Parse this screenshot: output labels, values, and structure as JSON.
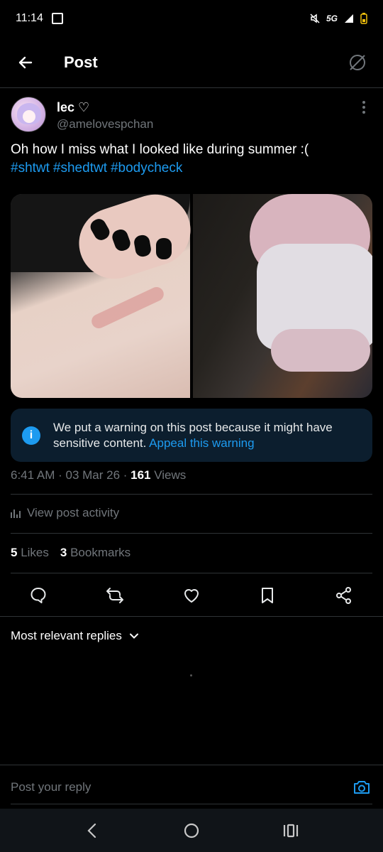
{
  "status_bar": {
    "time": "11:14",
    "network": "5G"
  },
  "header": {
    "title": "Post"
  },
  "author": {
    "name": "lec ♡",
    "handle": "@amelovespchan"
  },
  "post": {
    "text": "Oh how I miss what I looked like during summer :(",
    "hashtags": [
      "#shtwt",
      "#shedtwt",
      "#bodycheck"
    ]
  },
  "warning": {
    "message": "We put a warning on this post because it might have sensitive content.",
    "link": "Appeal this warning"
  },
  "meta": {
    "time": "6:41 AM",
    "sep1": " · ",
    "date": "03 Mar 26",
    "sep2": " · ",
    "views_count": "161",
    "views_label": " Views"
  },
  "activity": {
    "label": "View post activity"
  },
  "stats": {
    "likes_count": "5",
    "likes_label": "Likes",
    "bookmarks_count": "3",
    "bookmarks_label": "Bookmarks"
  },
  "replies": {
    "filter_label": "Most relevant replies"
  },
  "reply_bar": {
    "placeholder": "Post your reply"
  },
  "icons": {
    "back": "arrow-left-icon",
    "grok": "grok-icon",
    "more": "more-vertical-icon",
    "reply": "reply-icon",
    "repost": "repost-icon",
    "like": "heart-icon",
    "bookmark": "bookmark-icon",
    "share": "share-icon",
    "camera": "camera-icon"
  },
  "colors": {
    "accent": "#1d9bf0",
    "background": "#000000",
    "muted": "#71767b"
  }
}
